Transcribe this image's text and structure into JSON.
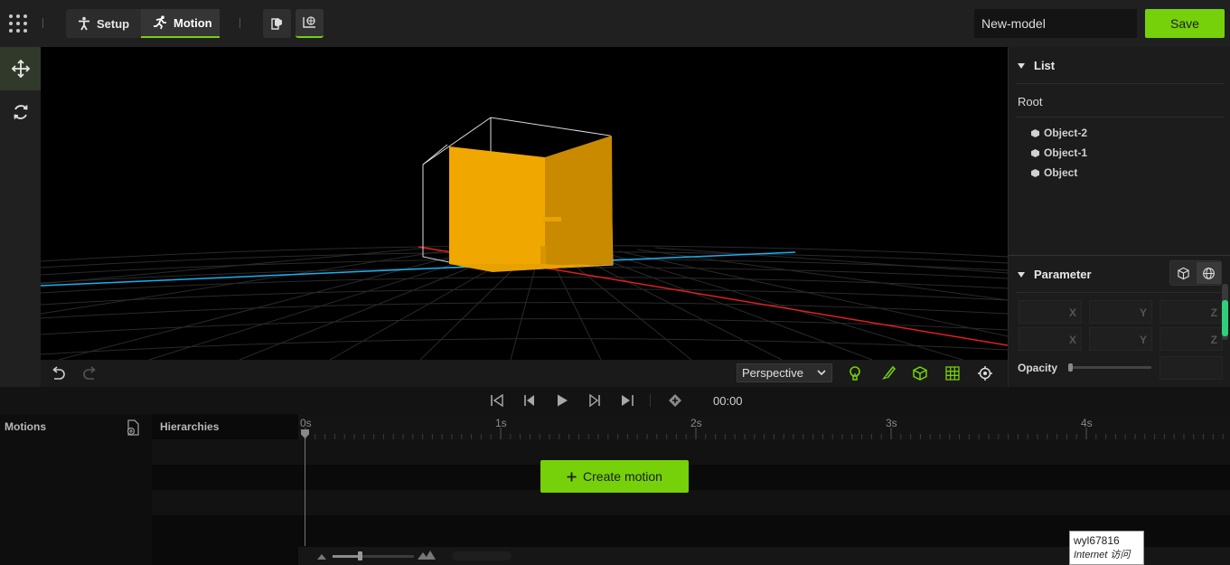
{
  "topbar": {
    "modes": [
      {
        "label": "Setup",
        "icon": "person-icon",
        "active": false
      },
      {
        "label": "Motion",
        "icon": "running-icon",
        "active": true
      }
    ],
    "view_buttons": [
      {
        "icon": "model-box-icon",
        "active": false
      },
      {
        "icon": "world-grid-icon",
        "active": true
      }
    ],
    "model_name": "New-model",
    "save_label": "Save"
  },
  "left_tools": [
    {
      "icon": "move-arrows-icon",
      "active": true
    },
    {
      "icon": "rotate-icon",
      "active": false
    }
  ],
  "viewport": {
    "camera_mode": "Perspective",
    "camera_options": [
      "Perspective"
    ],
    "tool_icons": [
      "lightbulb-icon",
      "paint-brush-icon",
      "cube-icon",
      "grid-icon",
      "target-icon"
    ]
  },
  "panel": {
    "list_title": "List",
    "root_label": "Root",
    "objects": [
      "Object-2",
      "Object-1",
      "Object"
    ],
    "parameter_title": "Parameter",
    "axis_labels": [
      "X",
      "Y",
      "Z"
    ],
    "opacity_label": "Opacity",
    "opacity_value": 0
  },
  "timeline": {
    "timecode": "00:00",
    "motions_title": "Motions",
    "hierarchies_title": "Hierarchies",
    "ticks": [
      "0s",
      "1s",
      "2s",
      "3s",
      "4s"
    ],
    "create_motion_label": "Create motion",
    "zoom_level": 0.33
  },
  "tooltip": {
    "line1": "wyl67816",
    "line2": "Internet 访问"
  },
  "colors": {
    "accent": "#76d10a",
    "object": "#f0a800",
    "axis_x": "#e02020",
    "axis_z": "#1ab0f0"
  }
}
